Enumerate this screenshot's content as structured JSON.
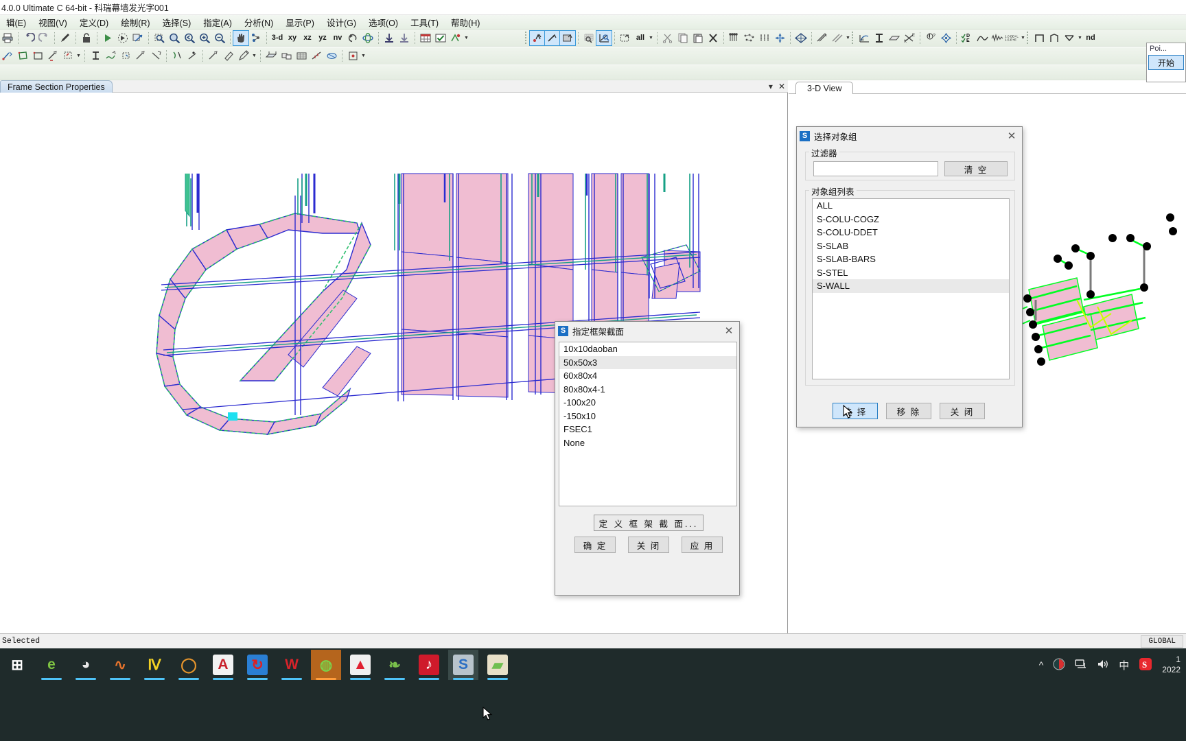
{
  "window": {
    "title": "4.0.0 Ultimate C 64-bit - 科瑞幕墙发光字001"
  },
  "menubar": {
    "items": [
      {
        "label": "辑(E)"
      },
      {
        "label": "视图(V)"
      },
      {
        "label": "定义(D)"
      },
      {
        "label": "绘制(R)"
      },
      {
        "label": "选择(S)"
      },
      {
        "label": "指定(A)"
      },
      {
        "label": "分析(N)"
      },
      {
        "label": "显示(P)"
      },
      {
        "label": "设计(G)"
      },
      {
        "label": "选项(O)"
      },
      {
        "label": "工具(T)"
      },
      {
        "label": "帮助(H)"
      }
    ]
  },
  "toolbar": {
    "axis_labels": [
      "3-d",
      "xy",
      "xz",
      "yz",
      "nv"
    ],
    "all_label": "all",
    "nd_label": "nd",
    "de_label": "D+L",
    "de_label2": "+E",
    "num1": "1.0 D",
    "num2": "1.5 E"
  },
  "left_panel": {
    "tab_label": "Frame Section Properties",
    "dropdown_icon": "chevron-down-icon",
    "close_icon": "close-icon"
  },
  "right_view": {
    "tab_label": "3-D View"
  },
  "flyout": {
    "title": "Poi...",
    "button_label": "开始"
  },
  "frame_section_dialog": {
    "title": "指定框架截面",
    "icon_letter": "S",
    "items": [
      "10x10daoban",
      "50x50x3",
      "60x80x4",
      "80x80x4-1",
      "-100x20",
      "-150x10",
      "FSEC1",
      "None"
    ],
    "selected_index": 1,
    "define_button": "定 义 框 架 截 面...",
    "ok_button": "确 定",
    "close_button": "关 闭",
    "apply_button": "应 用"
  },
  "select_group_dialog": {
    "title": "选择对象组",
    "icon_letter": "S",
    "filter_label": "过滤器",
    "filter_value": "",
    "clear_button": "清 空",
    "list_label": "对象组列表",
    "items": [
      "ALL",
      "S-COLU-COGZ",
      "S-COLU-DDET",
      "S-SLAB",
      "S-SLAB-BARS",
      "S-STEL",
      "S-WALL"
    ],
    "selected_index": 6,
    "select_button": "选 择",
    "remove_button": "移 除",
    "close_button": "关 闭"
  },
  "statusbar": {
    "left_text": "Selected",
    "right_text": "GLOBAL"
  },
  "taskbar": {
    "start_icon": "task-view-icon",
    "apps": [
      {
        "name": "task-view-icon",
        "glyph": "⊞",
        "color": "#ffffff",
        "bg": "transparent",
        "running": false
      },
      {
        "name": "edge-browser-icon",
        "glyph": "e",
        "color": "#7dc242",
        "bg": "transparent",
        "running": true
      },
      {
        "name": "media-player-icon",
        "glyph": "◕",
        "color": "#e8e8e8",
        "bg": "transparent",
        "running": true
      },
      {
        "name": "matlab-icon",
        "glyph": "∿",
        "color": "#e8742c",
        "bg": "transparent",
        "running": true
      },
      {
        "name": "autocad-icon",
        "glyph": "Ⅳ",
        "color": "#f2d024",
        "bg": "transparent",
        "running": true
      },
      {
        "name": "search-icon",
        "glyph": "◯",
        "color": "#e8962c",
        "bg": "transparent",
        "running": true
      },
      {
        "name": "pdf-reader-icon",
        "glyph": "A",
        "color": "#c8202a",
        "bg": "#f2f2f2",
        "running": true
      },
      {
        "name": "sync-icon",
        "glyph": "↻",
        "color": "#e02020",
        "bg": "#2a7fd4",
        "running": true
      },
      {
        "name": "wps-writer-icon",
        "glyph": "W",
        "color": "#d8232a",
        "bg": "transparent",
        "running": true
      },
      {
        "name": "wechat-icon",
        "glyph": "◍",
        "color": "#7bd14a",
        "bg": "#b5651d",
        "running": true
      },
      {
        "name": "adobe-icon",
        "glyph": "▲",
        "color": "#e02030",
        "bg": "#f0f0f0",
        "running": true
      },
      {
        "name": "clover-icon",
        "glyph": "❧",
        "color": "#79c04b",
        "bg": "transparent",
        "running": true
      },
      {
        "name": "netease-music-icon",
        "glyph": "♪",
        "color": "#ffffff",
        "bg": "#cf1a2b",
        "running": true
      },
      {
        "name": "sap2000-icon",
        "glyph": "S",
        "color": "#2a6fc4",
        "bg": "#b8c4cc",
        "running": true
      },
      {
        "name": "image-viewer-icon",
        "glyph": "▰",
        "color": "#6fbf50",
        "bg": "#e8e0c8",
        "running": true
      }
    ],
    "tray": {
      "chevron": "^",
      "security_icon": "security-shield-icon",
      "network_icon": "network-icon",
      "volume_icon": "volume-icon",
      "ime_label": "中",
      "sogou_icon": "S"
    },
    "clock": {
      "time": "1",
      "date": "2022"
    }
  }
}
